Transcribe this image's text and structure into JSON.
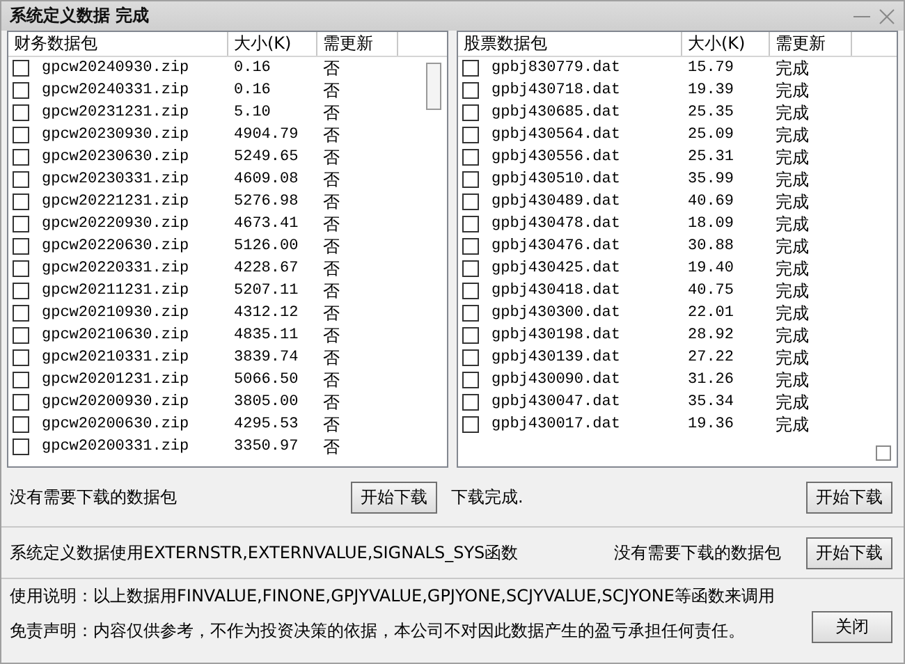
{
  "window": {
    "title": "系统定义数据 完成"
  },
  "finance_list": {
    "columns": [
      "财务数据包",
      "大小(K)",
      "需更新"
    ],
    "rows": [
      {
        "name": "gpcw20240930.zip",
        "size": "0.16",
        "update": "否",
        "checked": false
      },
      {
        "name": "gpcw20240331.zip",
        "size": "0.16",
        "update": "否",
        "checked": false
      },
      {
        "name": "gpcw20231231.zip",
        "size": "5.10",
        "update": "否",
        "checked": false
      },
      {
        "name": "gpcw20230930.zip",
        "size": "4904.79",
        "update": "否",
        "checked": false
      },
      {
        "name": "gpcw20230630.zip",
        "size": "5249.65",
        "update": "否",
        "checked": false
      },
      {
        "name": "gpcw20230331.zip",
        "size": "4609.08",
        "update": "否",
        "checked": false
      },
      {
        "name": "gpcw20221231.zip",
        "size": "5276.98",
        "update": "否",
        "checked": false
      },
      {
        "name": "gpcw20220930.zip",
        "size": "4673.41",
        "update": "否",
        "checked": false
      },
      {
        "name": "gpcw20220630.zip",
        "size": "5126.00",
        "update": "否",
        "checked": false
      },
      {
        "name": "gpcw20220331.zip",
        "size": "4228.67",
        "update": "否",
        "checked": false
      },
      {
        "name": "gpcw20211231.zip",
        "size": "5207.11",
        "update": "否",
        "checked": false
      },
      {
        "name": "gpcw20210930.zip",
        "size": "4312.12",
        "update": "否",
        "checked": false
      },
      {
        "name": "gpcw20210630.zip",
        "size": "4835.11",
        "update": "否",
        "checked": false
      },
      {
        "name": "gpcw20210331.zip",
        "size": "3839.74",
        "update": "否",
        "checked": false
      },
      {
        "name": "gpcw20201231.zip",
        "size": "5066.50",
        "update": "否",
        "checked": false
      },
      {
        "name": "gpcw20200930.zip",
        "size": "3805.00",
        "update": "否",
        "checked": false
      },
      {
        "name": "gpcw20200630.zip",
        "size": "4295.53",
        "update": "否",
        "checked": false
      },
      {
        "name": "gpcw20200331.zip",
        "size": "3350.97",
        "update": "否",
        "checked": false
      }
    ]
  },
  "stock_list": {
    "columns": [
      "股票数据包",
      "大小(K)",
      "需更新"
    ],
    "rows": [
      {
        "name": "gpbj830779.dat",
        "size": "15.79",
        "update": "完成",
        "checked": false
      },
      {
        "name": "gpbj430718.dat",
        "size": "19.39",
        "update": "完成",
        "checked": false
      },
      {
        "name": "gpbj430685.dat",
        "size": "25.35",
        "update": "完成",
        "checked": false
      },
      {
        "name": "gpbj430564.dat",
        "size": "25.09",
        "update": "完成",
        "checked": false
      },
      {
        "name": "gpbj430556.dat",
        "size": "25.31",
        "update": "完成",
        "checked": false
      },
      {
        "name": "gpbj430510.dat",
        "size": "35.99",
        "update": "完成",
        "checked": false
      },
      {
        "name": "gpbj430489.dat",
        "size": "40.69",
        "update": "完成",
        "checked": false
      },
      {
        "name": "gpbj430478.dat",
        "size": "18.09",
        "update": "完成",
        "checked": false
      },
      {
        "name": "gpbj430476.dat",
        "size": "30.88",
        "update": "完成",
        "checked": false
      },
      {
        "name": "gpbj430425.dat",
        "size": "19.40",
        "update": "完成",
        "checked": false
      },
      {
        "name": "gpbj430418.dat",
        "size": "40.75",
        "update": "完成",
        "checked": false
      },
      {
        "name": "gpbj430300.dat",
        "size": "22.01",
        "update": "完成",
        "checked": false
      },
      {
        "name": "gpbj430198.dat",
        "size": "28.92",
        "update": "完成",
        "checked": false
      },
      {
        "name": "gpbj430139.dat",
        "size": "27.22",
        "update": "完成",
        "checked": false
      },
      {
        "name": "gpbj430090.dat",
        "size": "31.26",
        "update": "完成",
        "checked": false
      },
      {
        "name": "gpbj430047.dat",
        "size": "35.34",
        "update": "完成",
        "checked": false
      },
      {
        "name": "gpbj430017.dat",
        "size": "19.36",
        "update": "完成",
        "checked": false
      }
    ]
  },
  "finance_status": "没有需要下载的数据包",
  "finance_button": "开始下载",
  "stock_status": "下载完成.",
  "stock_button": "开始下载",
  "system_note": "系统定义数据使用EXTERNSTR,EXTERNVALUE,SIGNALS_SYS函数",
  "system_status": "没有需要下载的数据包",
  "system_button": "开始下载",
  "usage": "使用说明：以上数据用FINVALUE,FINONE,GPJYVALUE,GPJYONE,SCJYVALUE,SCJYONE等函数来调用",
  "disclaimer": "免责声明：内容仅供参考，不作为投资决策的依据，本公司不对因此数据产生的盈亏承担任何责任。",
  "close_button": "关闭"
}
